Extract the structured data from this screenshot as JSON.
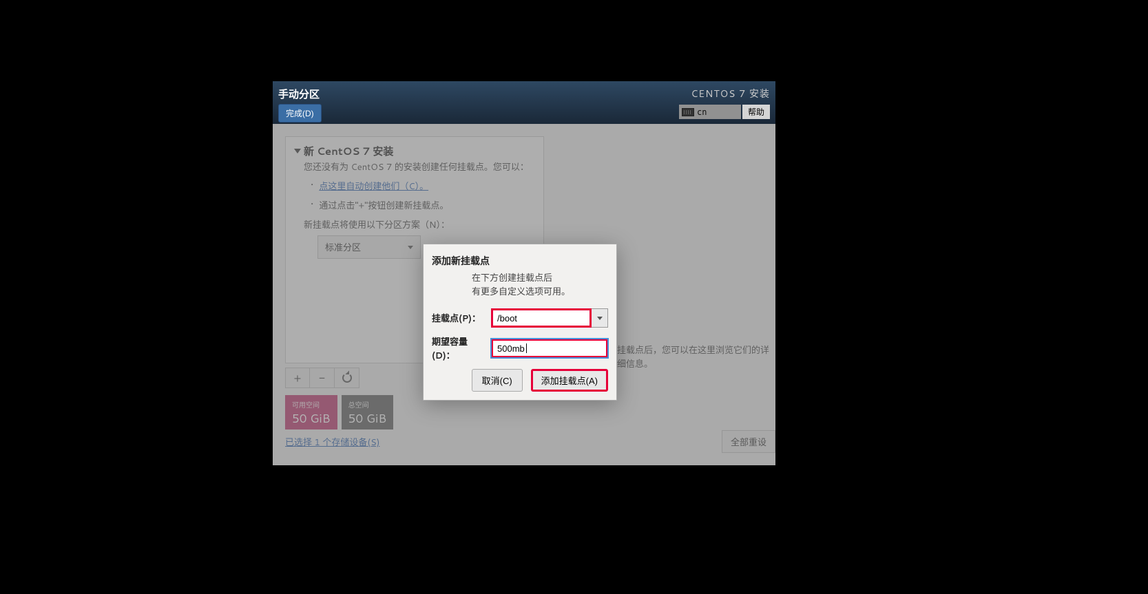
{
  "header": {
    "title": "手动分区",
    "done_label": "完成(D)",
    "installer_label": "CENTOS 7 安装",
    "keyboard_layout": "cn",
    "help_label": "帮助"
  },
  "sidebar": {
    "section_title": "新 CentOS 7 安装",
    "section_desc": "您还没有为 CentOS 7 的安装创建任何挂载点。您可以：",
    "auto_create_link": "点这里自动创建他们（C）。",
    "manual_hint": "通过点击\"+\"按钮创建新挂载点。",
    "scheme_label": "新挂载点将使用以下分区方案（N）：",
    "scheme_value": "标准分区"
  },
  "right_panel_hint": "挂载点后，您可以在这里浏览它们的详细信息。",
  "toolbar": {
    "add": "+",
    "remove": "−"
  },
  "space": {
    "available_label": "可用空间",
    "available_value": "50 GiB",
    "total_label": "总空间",
    "total_value": "50 GiB"
  },
  "storage_link": "已选择 1 个存储设备(S)",
  "reset_label": "全部重设",
  "modal": {
    "title": "添加新挂载点",
    "desc_line1": "在下方创建挂载点后",
    "desc_line2": "有更多自定义选项可用。",
    "mount_label": "挂载点(P)：",
    "mount_value": "/boot",
    "capacity_label": "期望容量(D)：",
    "capacity_value": "500mb",
    "cancel_label": "取消(C)",
    "add_label": "添加挂载点(A)"
  }
}
